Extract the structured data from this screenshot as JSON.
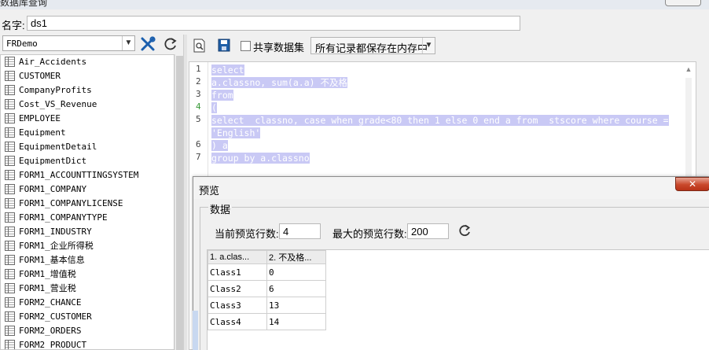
{
  "window": {
    "title": "数据库查询"
  },
  "name_field": {
    "label": "名字:",
    "value": "ds1"
  },
  "left_panel": {
    "datasource": "FRDemo",
    "tables": [
      "Air_Accidents",
      "CUSTOMER",
      "CompanyProfits",
      "Cost_VS_Revenue",
      "EMPLOYEE",
      "Equipment",
      "EquipmentDetail",
      "EquipmentDict",
      "FORM1_ACCOUNTTINGSYSTEM",
      "FORM1_COMPANY",
      "FORM1_COMPANYLICENSE",
      "FORM1_COMPANYTYPE",
      "FORM1_INDUSTRY",
      "FORM1_企业所得税",
      "FORM1_基本信息",
      "FORM1_增值税",
      "FORM1_营业税",
      "FORM2_CHANCE",
      "FORM2_CUSTOMER",
      "FORM2_ORDERS",
      "FORM2_PRODUCT"
    ]
  },
  "toolbar": {
    "share_label": "共享数据集",
    "memory_option": "所有记录都保存在内存中"
  },
  "sql": {
    "lines": [
      {
        "num": "1",
        "text": "select"
      },
      {
        "num": "2",
        "text": "a.classno, sum(a.a) 不及格"
      },
      {
        "num": "3",
        "text": "from"
      },
      {
        "num": "4",
        "text": "("
      },
      {
        "num": "5",
        "text": "select  classno, case when grade<80 then 1 else 0 end a from  stscore where course ="
      },
      {
        "num": "",
        "text": "'English'"
      },
      {
        "num": "6",
        "text": ") a"
      },
      {
        "num": "7",
        "text": "group by a.classno"
      }
    ]
  },
  "preview": {
    "title": "预览",
    "close_glyph": "✕",
    "group_label": "数据",
    "current_rows_label": "当前预览行数:",
    "current_rows_value": "4",
    "max_rows_label": "最大的预览行数:",
    "max_rows_value": "200",
    "columns": [
      "1. a.clas...",
      "2. 不及格..."
    ],
    "rows": [
      [
        "Class1",
        "0"
      ],
      [
        "Class2",
        "6"
      ],
      [
        "Class3",
        "13"
      ],
      [
        "Class4",
        "14"
      ]
    ]
  }
}
